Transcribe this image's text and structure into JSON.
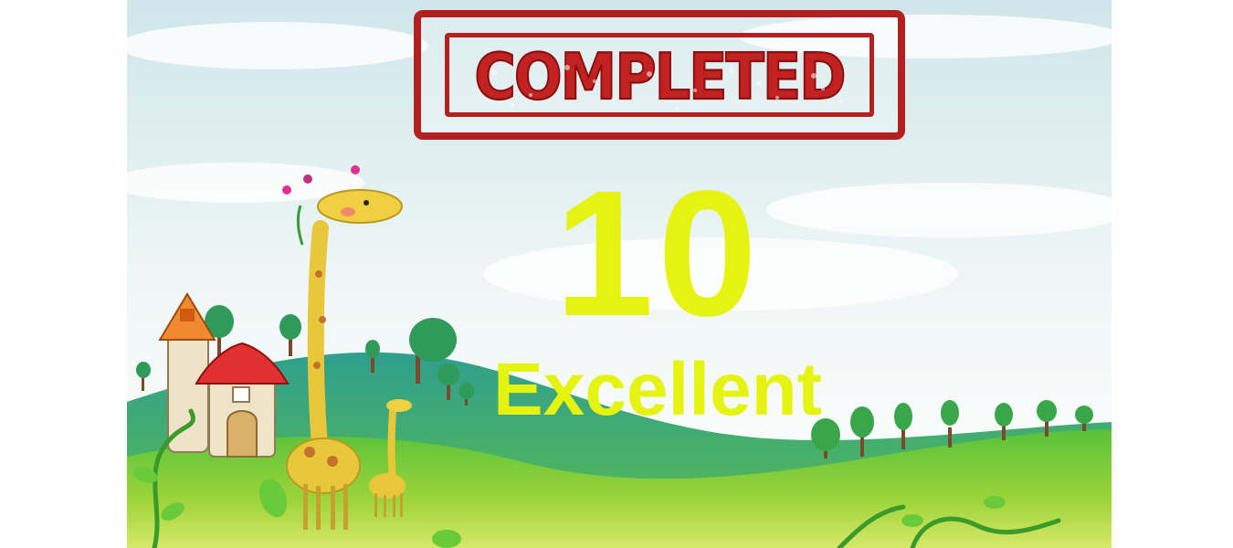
{
  "stamp": {
    "label": "COMPLETED",
    "color": "#b32020"
  },
  "result": {
    "score": "10",
    "rating": "Excellent",
    "color": "#e6f20f"
  },
  "background": {
    "sky_color": "#dfeef0",
    "hill_color": "#3fae3a",
    "description_icons": [
      "giraffe-icon",
      "house-icon",
      "tree-icon",
      "vine-icon"
    ]
  }
}
